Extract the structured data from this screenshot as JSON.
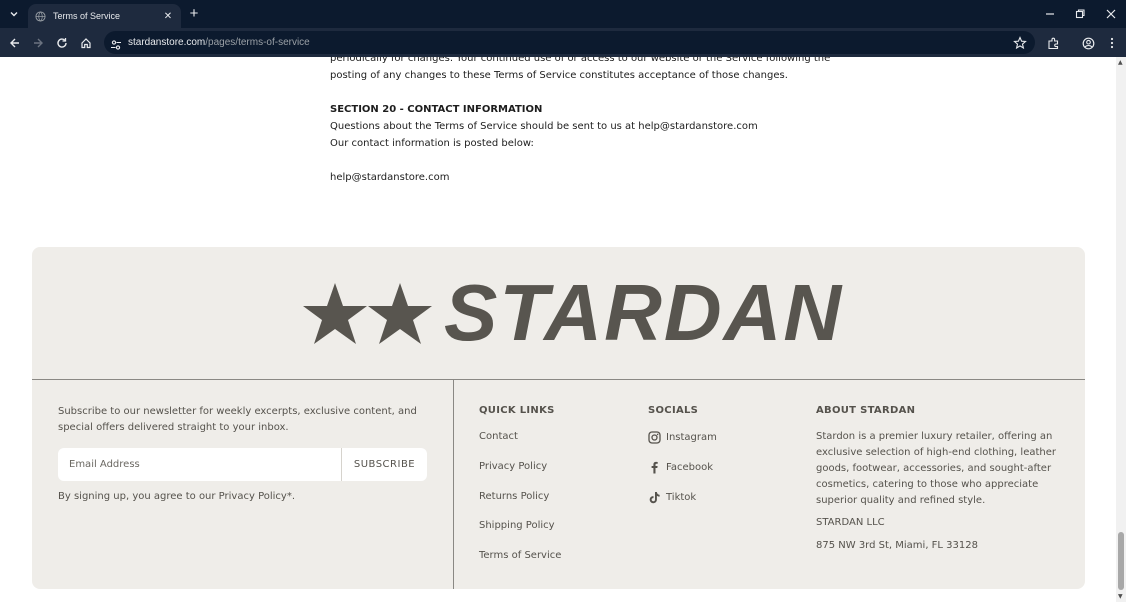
{
  "browser": {
    "tab_title": "Terms of Service",
    "url_domain": "stardanstore.com",
    "url_path": "/pages/terms-of-service"
  },
  "tos": {
    "line1": "periodically for changes. Your continued use of or access to our website or the Service following the",
    "line2": "posting of any changes to these Terms of Service constitutes acceptance of those changes.",
    "section_heading": "SECTION 20 - CONTACT INFORMATION",
    "line3": "Questions about the Terms of Service should be sent to us at help@stardanstore.com",
    "line4": "Our contact information is posted below:",
    "email": "help@stardanstore.com"
  },
  "footer": {
    "brand": "STARDAN",
    "newsletter_text": "Subscribe to our newsletter for weekly excerpts, exclusive content, and special offers delivered straight to your inbox.",
    "email_placeholder": "Email Address",
    "subscribe_label": "SUBSCRIBE",
    "consent": "By signing up, you agree to our Privacy Policy*.",
    "quick_links_heading": "QUICK LINKS",
    "quick_links": [
      "Contact",
      "Privacy Policy",
      "Returns Policy",
      "Shipping Policy",
      "Terms of Service"
    ],
    "socials_heading": "SOCIALS",
    "socials": [
      {
        "label": "Instagram",
        "icon": "instagram-icon"
      },
      {
        "label": "Facebook",
        "icon": "facebook-icon"
      },
      {
        "label": "Tiktok",
        "icon": "tiktok-icon"
      }
    ],
    "about_heading": "ABOUT STARDAN",
    "about_text": "Stardon is a premier luxury retailer, offering an exclusive selection of high-end clothing, leather goods, footwear, accessories, and sought-after cosmetics, catering to those who appreciate superior quality and refined style.",
    "company": "STARDAN LLC",
    "address": "875 NW 3rd St, Miami, FL 33128"
  },
  "colors": {
    "footer_bg": "#efede9",
    "footer_text": "#55524c",
    "brand": "#58554f",
    "chrome_dark": "#0c1a2e",
    "chrome_tab": "#1e2a3e"
  }
}
